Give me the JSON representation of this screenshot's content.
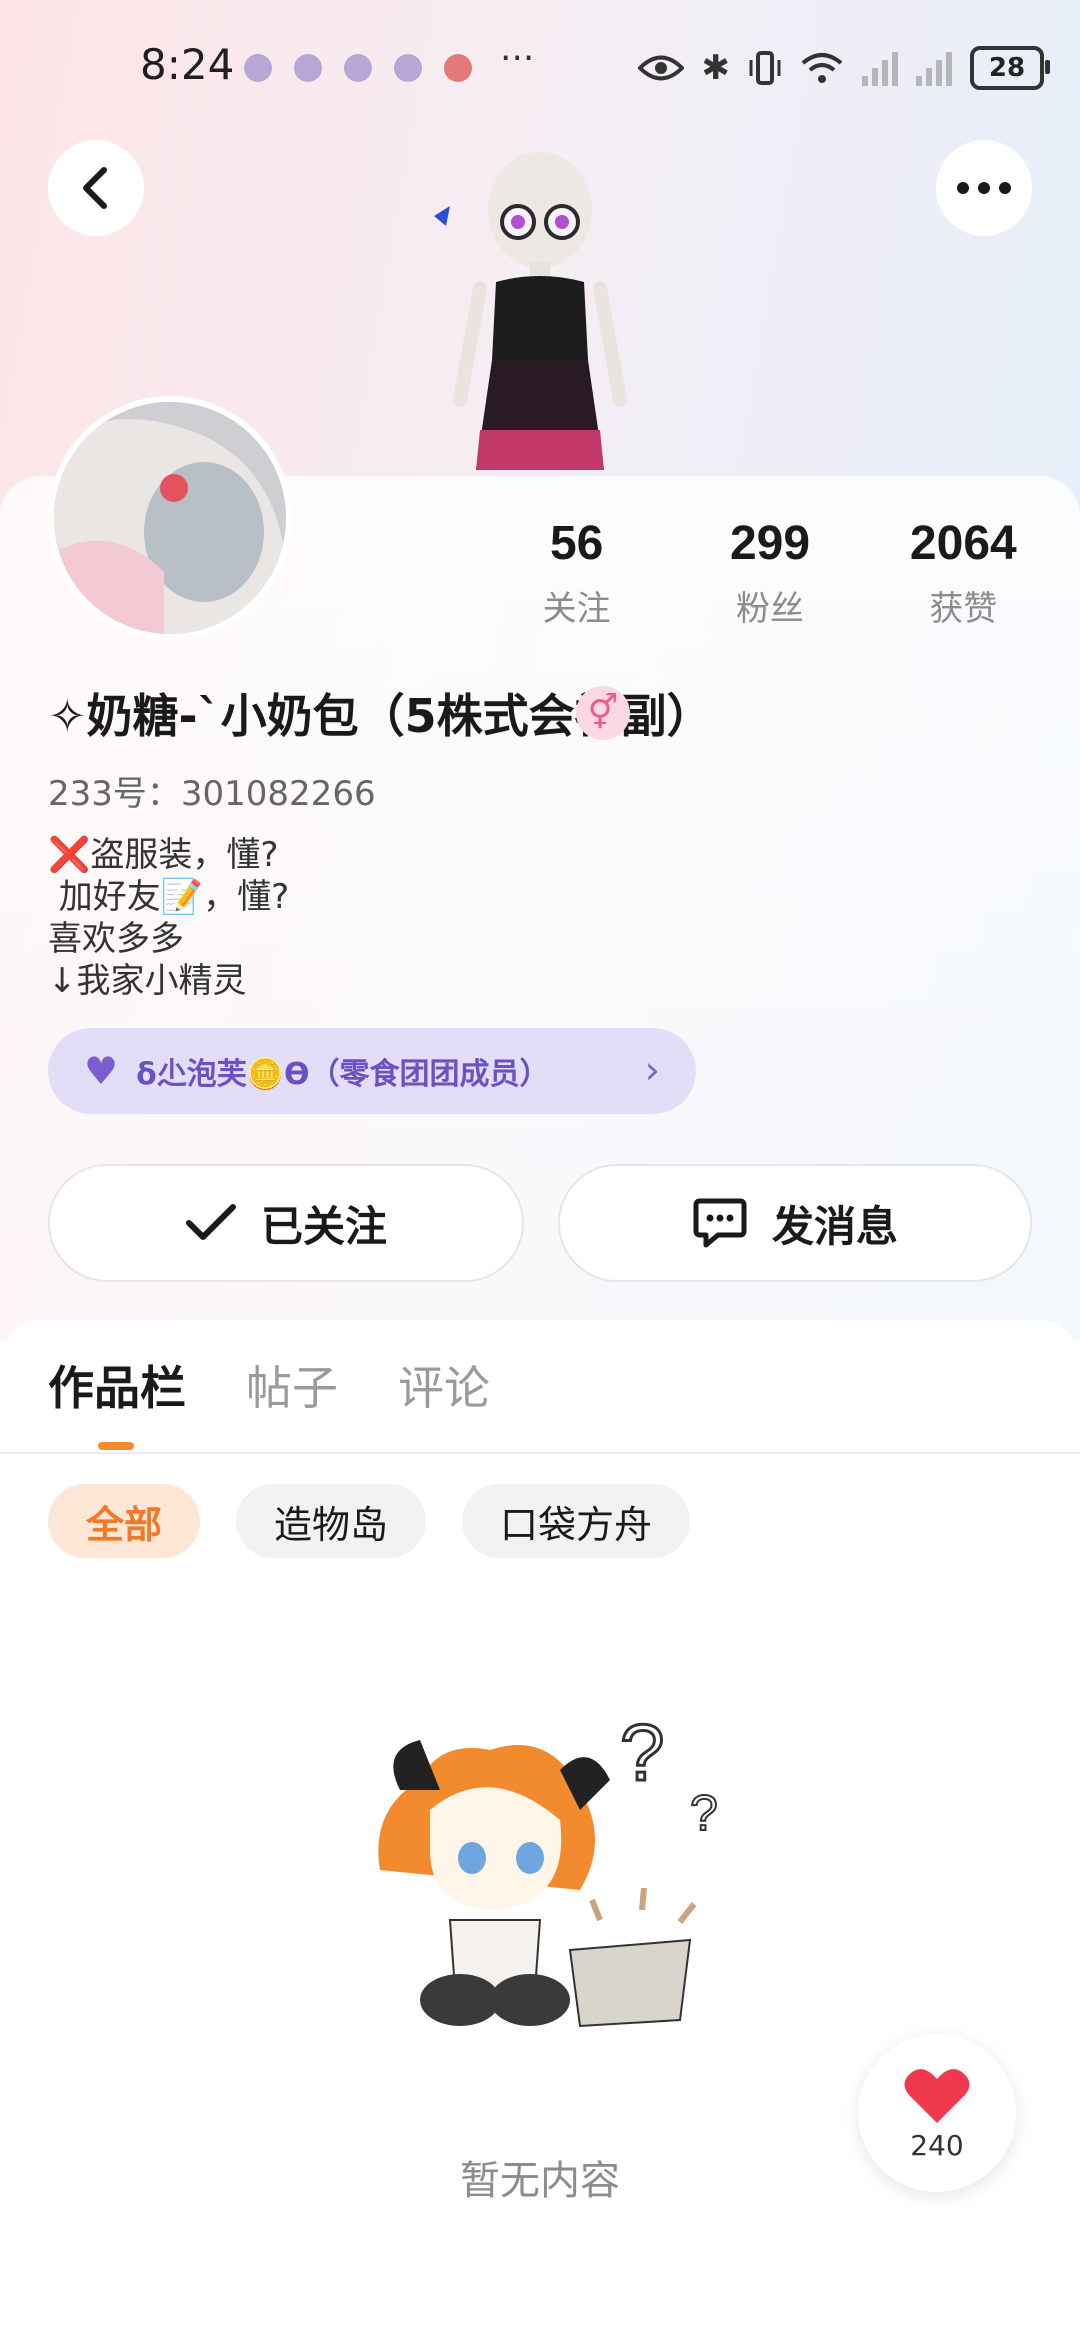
{
  "status_bar": {
    "time": "8:24",
    "more": "···",
    "battery": "28"
  },
  "profile": {
    "nickname": "✧奶糖-`小奶包（5株式会社副）",
    "gender_symbol": "⚥",
    "user_id": "233号：301082266",
    "bio_lines": [
      "❌盗服装，懂?",
      " 加好友📝，懂?",
      "喜欢多多",
      "↓我家小精灵"
    ],
    "stats": [
      {
        "value": "56",
        "label": "关注"
      },
      {
        "value": "299",
        "label": "粉丝"
      },
      {
        "value": "2064",
        "label": "获赞"
      }
    ],
    "group": "ẟ尐泡芙🪙ϴ（零食团团成员）"
  },
  "actions": {
    "follow_label": "已关注",
    "message_label": "发消息"
  },
  "tabs": [
    "作品栏",
    "帖子",
    "评论"
  ],
  "chips": [
    "全部",
    "造物岛",
    "口袋方舟"
  ],
  "empty_text": "暂无内容",
  "like_count": "240",
  "colors": {
    "accent_orange": "#f28a2e",
    "group_purple": "#6b52c4",
    "heart_red": "#f0384f"
  }
}
